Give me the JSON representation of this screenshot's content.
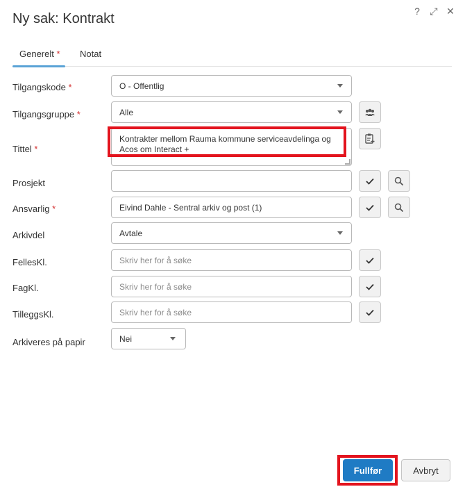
{
  "dialog": {
    "title": "Ny sak: Kontrakt",
    "help_icon": "question-icon",
    "expand_icon": "expand-icon",
    "close_icon": "close-icon"
  },
  "tabs": [
    {
      "label": "Generelt",
      "required_marker": "*",
      "active": true
    },
    {
      "label": "Notat",
      "active": false
    }
  ],
  "form": {
    "tilgangskode": {
      "label": "Tilgangskode",
      "required_marker": "*",
      "value": "O - Offentlig"
    },
    "tilgangsgruppe": {
      "label": "Tilgangsgruppe",
      "required_marker": "*",
      "value": "Alle",
      "button_icon": "group-icon"
    },
    "tittel": {
      "label": "Tittel",
      "required_marker": "*",
      "value_line1": "Kontrakter mellom Rauma kommune serviceavdelinga og",
      "value_line2": "Acos om Interact +",
      "button_icon": "template-icon"
    },
    "prosjekt": {
      "label": "Prosjekt",
      "value": "",
      "check_icon": "check-icon",
      "search_icon": "search-icon"
    },
    "ansvarlig": {
      "label": "Ansvarlig",
      "required_marker": "*",
      "value": "Eivind Dahle - Sentral arkiv og post (1)",
      "check_icon": "check-icon",
      "search_icon": "search-icon"
    },
    "arkivdel": {
      "label": "Arkivdel",
      "value": "Avtale"
    },
    "felleskl": {
      "label": "FellesKl.",
      "placeholder": "Skriv her for å søke",
      "check_icon": "check-icon"
    },
    "fagkl": {
      "label": "FagKl.",
      "placeholder": "Skriv her for å søke",
      "check_icon": "check-icon"
    },
    "tilleggskl": {
      "label": "TilleggsKl.",
      "placeholder": "Skriv her for å søke",
      "check_icon": "check-icon"
    },
    "arkiveres_pa_papir": {
      "label": "Arkiveres på papir",
      "value": "Nei"
    }
  },
  "footer": {
    "primary_label": "Fullfør",
    "secondary_label": "Avbryt"
  },
  "colors": {
    "primary": "#1f7bc4",
    "required": "#d32f2f",
    "highlight": "#e3141e",
    "tab_underline": "#5aa3d6"
  }
}
